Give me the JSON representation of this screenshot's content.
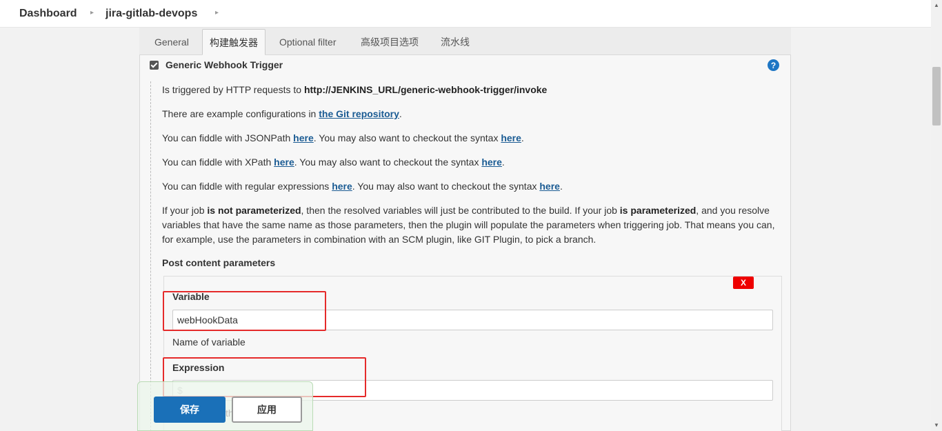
{
  "breadcrumb": {
    "items": [
      "Dashboard",
      "jira-gitlab-devops"
    ],
    "separator": "▸"
  },
  "tabs": [
    {
      "label": "General",
      "active": false
    },
    {
      "label": "构建触发器",
      "active": true
    },
    {
      "label": "Optional filter",
      "active": false
    },
    {
      "label": "高级项目选项",
      "active": false
    },
    {
      "label": "流水线",
      "active": false
    }
  ],
  "trigger": {
    "label": "Generic Webhook Trigger",
    "checked": true,
    "help_icon": "?"
  },
  "description": {
    "line1_prefix": "Is triggered by HTTP requests to ",
    "line1_url": "http://JENKINS_URL/generic-webhook-trigger/invoke",
    "line2_prefix": "There are example configurations in ",
    "line2_link": "the Git repository",
    "line2_suffix": ".",
    "line3_prefix": "You can fiddle with JSONPath ",
    "line3_link1": "here",
    "line3_mid": ". You may also want to checkout the syntax ",
    "line3_link2": "here",
    "line3_suffix": ".",
    "line4_prefix": "You can fiddle with XPath ",
    "line4_link1": "here",
    "line4_mid": ". You may also want to checkout the syntax ",
    "line4_link2": "here",
    "line4_suffix": ".",
    "line5_prefix": "You can fiddle with regular expressions ",
    "line5_link1": "here",
    "line5_mid": ". You may also want to checkout the syntax ",
    "line5_link2": "here",
    "line5_suffix": ".",
    "para_a": "If your job ",
    "para_b": "is not parameterized",
    "para_c": ", then the resolved variables will just be contributed to the build. If your job ",
    "para_d": "is parameterized",
    "para_e": ", and you resolve variables that have the same name as those parameters, then the plugin will populate the parameters when triggering job. That means you can, for example, use the parameters in combination with an SCM plugin, like GIT Plugin, to pick a branch."
  },
  "post_content": {
    "title": "Post content parameters",
    "delete_label": "X",
    "variable": {
      "label": "Variable",
      "value": "webHookData",
      "help": "Name of variable"
    },
    "expression": {
      "label": "Expression",
      "value": "",
      "placeholder": "$"
    }
  },
  "actions": {
    "save_label": "保存",
    "apply_label": "应用",
    "ghost_text": "th"
  },
  "colors": {
    "primary": "#1a70b8",
    "link": "#1a5b93",
    "danger": "#e00000",
    "highlight": "#e52a2a"
  }
}
